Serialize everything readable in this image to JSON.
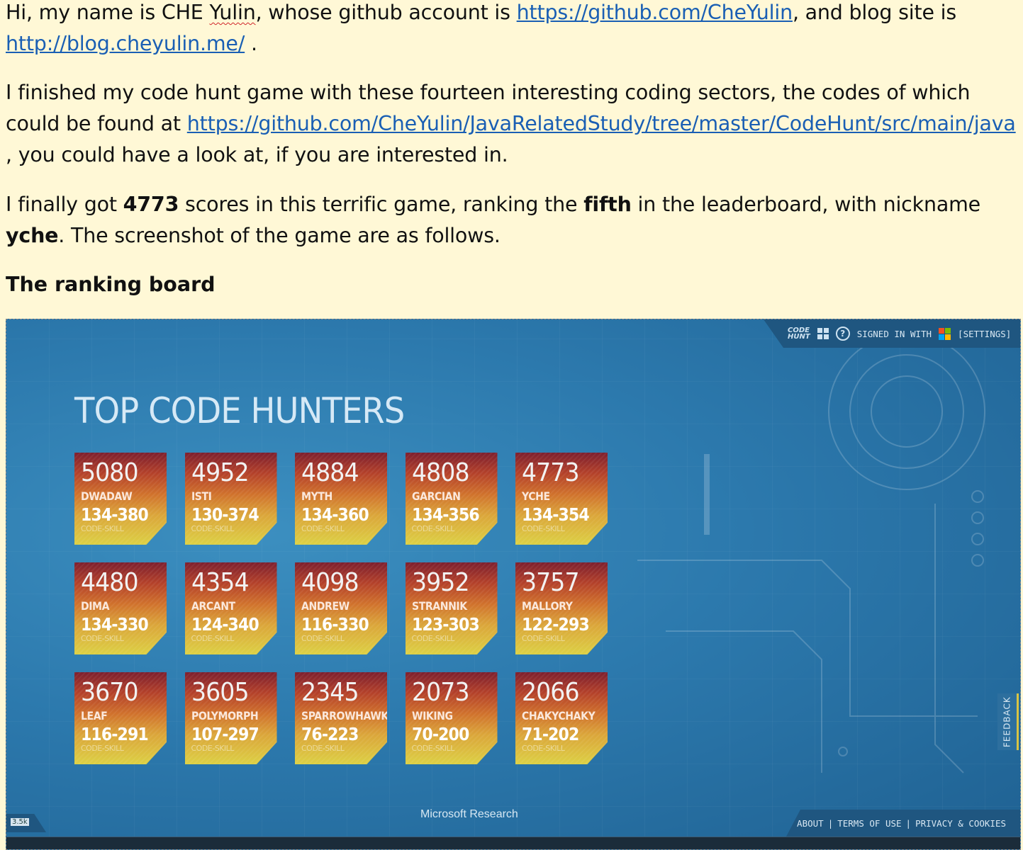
{
  "document": {
    "p1": {
      "before_name": "Hi, my name is CHE ",
      "name_squiggle": "Yulin",
      "mid": ", whose github account is ",
      "github_link": "https://github.com/CheYulin",
      "mid2": ", and blog site is",
      "blog_link": "http://blog.cheyulin.me/",
      "end": " ."
    },
    "p2": {
      "text1": "I finished my code hunt game with these fourteen interesting coding sectors, the codes of which could be found at ",
      "repo_link": "https://github.com/CheYulin/JavaRelatedStudy/tree/master/CodeHunt/src/main/java",
      "text2": " , you could have a look at, if you are interested in."
    },
    "p3": {
      "t1": "I finally got ",
      "score": "4773",
      "t2": " scores in this terrific game, ranking the ",
      "rank": "fifth",
      "t3": " in the leaderboard, with nickname ",
      "nick": "yche",
      "t4": ". The screenshot of the game are as follows."
    },
    "heading": "The ranking board"
  },
  "game": {
    "topbar": {
      "logo_line1": "CODE",
      "logo_line2": "HUNT",
      "signed_in": "SIGNED IN WITH",
      "settings": "[SETTINGS]"
    },
    "title": "TOP CODE HUNTERS",
    "skill_label": "CODE-SKILL",
    "leaders": [
      {
        "score": "5080",
        "name": "DWADAW",
        "code_skill": "134-380"
      },
      {
        "score": "4952",
        "name": "ISTI",
        "code_skill": "130-374"
      },
      {
        "score": "4884",
        "name": "MYTH",
        "code_skill": "134-360"
      },
      {
        "score": "4808",
        "name": "GARCIAN",
        "code_skill": "134-356"
      },
      {
        "score": "4773",
        "name": "YCHE",
        "code_skill": "134-354"
      },
      {
        "score": "4480",
        "name": "DIMA",
        "code_skill": "134-330"
      },
      {
        "score": "4354",
        "name": "ARCANT",
        "code_skill": "124-340"
      },
      {
        "score": "4098",
        "name": "ANDREW",
        "code_skill": "116-330"
      },
      {
        "score": "3952",
        "name": "STRANNIK",
        "code_skill": "123-303"
      },
      {
        "score": "3757",
        "name": "MALLORY",
        "code_skill": "122-293"
      },
      {
        "score": "3670",
        "name": "LEAF",
        "code_skill": "116-291"
      },
      {
        "score": "3605",
        "name": "POLYMORPH",
        "code_skill": "107-297"
      },
      {
        "score": "2345",
        "name": "SPARROWHAWK",
        "code_skill": "76-223"
      },
      {
        "score": "2073",
        "name": "WIKING",
        "code_skill": "70-200"
      },
      {
        "score": "2066",
        "name": "CHAKYCHAKY",
        "code_skill": "71-202"
      }
    ],
    "feedback": "FEEDBACK",
    "footer_org": "Microsoft Research",
    "footer_links": [
      "ABOUT",
      "TERMS OF USE",
      "PRIVACY & COOKIES"
    ],
    "zoom": "3.5k"
  }
}
